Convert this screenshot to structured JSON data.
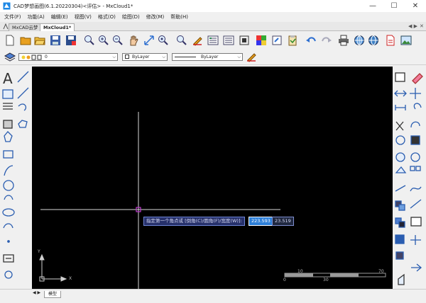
{
  "window": {
    "title": "CAD梦想画图(6.1.20220304)<评估> - MxCloud1*",
    "minimize": "—",
    "maximize": "☐",
    "close": "✕"
  },
  "menu": {
    "items": [
      "文件(F)",
      "功能(A)",
      "编辑(E)",
      "视图(V)",
      "格式(O)",
      "绘图(D)",
      "修改(M)",
      "帮助(H)"
    ]
  },
  "tabs": {
    "items": [
      "MxCAD云梦",
      "MxCloud1*"
    ],
    "active_index": 1,
    "nav_label": "◀ ▶",
    "close_label": "✕"
  },
  "properties": {
    "layer_value": "0",
    "color_value": "ByLayer",
    "linetype_value": "ByLayer"
  },
  "command": {
    "prompt": "指定第一个角点或 [倒角(C)/圆角(F)/宽度(W)]:",
    "x_value": "223.593",
    "y_value": "23.519"
  },
  "canvas": {
    "ucs_x_label": "X",
    "ucs_y_label": "Y",
    "scale_labels": [
      "10",
      "70",
      "0",
      "30"
    ]
  },
  "statusbar": {
    "nav_label": "◀ ▶",
    "model_tab": "模型"
  },
  "colors": {
    "canvas_bg": "#000000",
    "crosshair": "#d8d8d8",
    "cursor": "#c03bd0",
    "command_bg": "#26306a",
    "selected_input_bg": "#2d7fd8"
  }
}
